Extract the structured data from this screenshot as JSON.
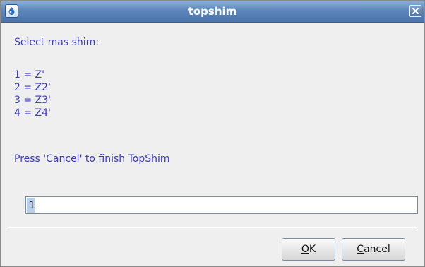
{
  "window": {
    "title": "topshim"
  },
  "message": {
    "prompt": "Select mas shim:",
    "options": [
      "1 = Z'",
      "2 = Z2'",
      "3 = Z3'",
      "4 = Z4'"
    ],
    "hint": "Press 'Cancel' to finish TopShim"
  },
  "input": {
    "value": "1"
  },
  "buttons": {
    "ok_mnemonic": "O",
    "ok_rest": "K",
    "cancel_mnemonic": "C",
    "cancel_rest": "ancel"
  },
  "colors": {
    "message_text": "#3b3bc8",
    "titlebar": "#5e86bb"
  },
  "icons": {
    "app": "topspin-app-icon",
    "close": "close-icon"
  }
}
